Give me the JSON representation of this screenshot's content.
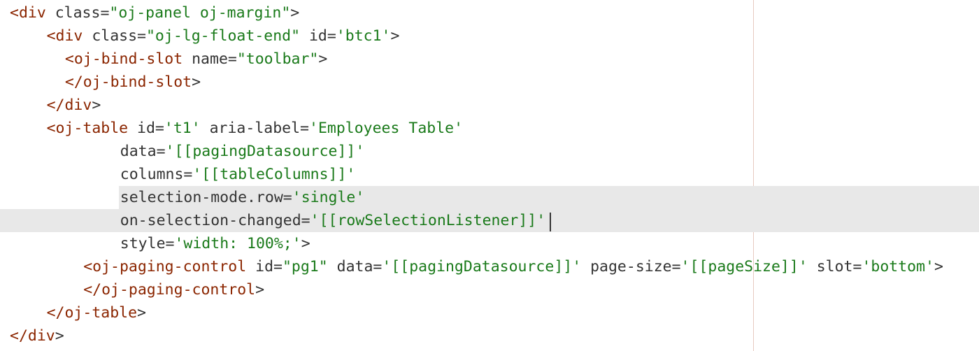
{
  "editor": {
    "highlighted_lines": [
      8,
      9
    ],
    "cursor_line": 9,
    "lines": [
      {
        "indent": 0,
        "tokens": [
          {
            "t": "<div",
            "c": "tag"
          },
          {
            "t": " class=",
            "c": "attr"
          },
          {
            "t": "\"oj-panel oj-margin\"",
            "c": "str"
          },
          {
            "t": ">",
            "c": "punct"
          }
        ]
      },
      {
        "indent": 2,
        "tokens": [
          {
            "t": "<div",
            "c": "tag"
          },
          {
            "t": " class=",
            "c": "attr"
          },
          {
            "t": "\"oj-lg-float-end\"",
            "c": "str"
          },
          {
            "t": " id=",
            "c": "attr"
          },
          {
            "t": "'btc1'",
            "c": "str"
          },
          {
            "t": ">",
            "c": "punct"
          }
        ]
      },
      {
        "indent": 3,
        "tokens": [
          {
            "t": "<oj-bind-slot",
            "c": "tag"
          },
          {
            "t": " name=",
            "c": "attr"
          },
          {
            "t": "\"toolbar\"",
            "c": "str"
          },
          {
            "t": ">",
            "c": "punct"
          }
        ]
      },
      {
        "indent": 3,
        "tokens": [
          {
            "t": "</oj-bind-slot",
            "c": "tag"
          },
          {
            "t": ">",
            "c": "punct"
          }
        ]
      },
      {
        "indent": 2,
        "tokens": [
          {
            "t": "</div",
            "c": "tag"
          },
          {
            "t": ">",
            "c": "punct"
          }
        ]
      },
      {
        "indent": 2,
        "tokens": [
          {
            "t": "<oj-table",
            "c": "tag"
          },
          {
            "t": " id=",
            "c": "attr"
          },
          {
            "t": "'t1'",
            "c": "str"
          },
          {
            "t": " aria-label=",
            "c": "attr"
          },
          {
            "t": "'Employees Table'",
            "c": "str"
          }
        ]
      },
      {
        "indent": 6,
        "tokens": [
          {
            "t": "data=",
            "c": "attr"
          },
          {
            "t": "'[[pagingDatasource]]'",
            "c": "str"
          }
        ]
      },
      {
        "indent": 6,
        "tokens": [
          {
            "t": "columns=",
            "c": "attr"
          },
          {
            "t": "'[[tableColumns]]'",
            "c": "str"
          }
        ]
      },
      {
        "indent": 6,
        "tokens": [
          {
            "t": "selection-mode.row=",
            "c": "attr"
          },
          {
            "t": "'single'",
            "c": "str"
          }
        ]
      },
      {
        "indent": 6,
        "tokens": [
          {
            "t": "on-selection-changed=",
            "c": "attr"
          },
          {
            "t": "'[[rowSelectionListener]]'",
            "c": "str"
          }
        ]
      },
      {
        "indent": 6,
        "tokens": [
          {
            "t": "style=",
            "c": "attr"
          },
          {
            "t": "'width: 100%;'",
            "c": "str"
          },
          {
            "t": ">",
            "c": "punct"
          }
        ]
      },
      {
        "indent": 4,
        "tokens": [
          {
            "t": "<oj-paging-control",
            "c": "tag"
          },
          {
            "t": " id=",
            "c": "attr"
          },
          {
            "t": "\"pg1\"",
            "c": "str"
          },
          {
            "t": " data=",
            "c": "attr"
          },
          {
            "t": "'[[pagingDatasource]]'",
            "c": "str"
          },
          {
            "t": " page-size=",
            "c": "attr"
          },
          {
            "t": "'[[pageSize]]'",
            "c": "str"
          },
          {
            "t": " slot=",
            "c": "attr"
          },
          {
            "t": "'bottom'",
            "c": "str"
          },
          {
            "t": ">",
            "c": "punct"
          }
        ]
      },
      {
        "indent": 4,
        "tokens": [
          {
            "t": "</oj-paging-control",
            "c": "tag"
          },
          {
            "t": ">",
            "c": "punct"
          }
        ]
      },
      {
        "indent": 2,
        "tokens": [
          {
            "t": "</oj-table",
            "c": "tag"
          },
          {
            "t": ">",
            "c": "punct"
          }
        ]
      },
      {
        "indent": 0,
        "tokens": [
          {
            "t": "</div",
            "c": "tag"
          },
          {
            "t": ">",
            "c": "punct"
          }
        ]
      }
    ]
  }
}
